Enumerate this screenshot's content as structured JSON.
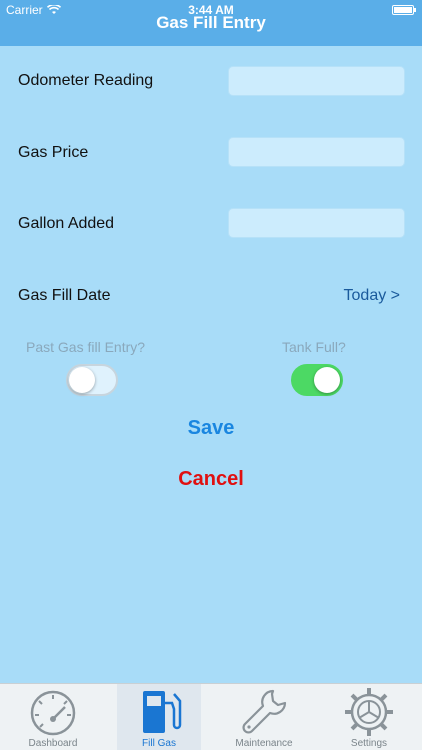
{
  "status": {
    "carrier": "Carrier",
    "time": "3:44 AM"
  },
  "nav": {
    "title": "Gas Fill Entry"
  },
  "form": {
    "odometer_label": "Odometer Reading",
    "odometer_value": "",
    "price_label": "Gas Price",
    "price_value": "",
    "gallon_label": "Gallon Added",
    "gallon_value": "",
    "date_label": "Gas Fill Date",
    "date_value": "Today >"
  },
  "toggles": {
    "past_label": "Past Gas fill Entry?",
    "past_on": false,
    "tank_label": "Tank Full?",
    "tank_on": true,
    "on_color": "#4cd964"
  },
  "actions": {
    "save": "Save",
    "cancel": "Cancel",
    "save_color": "#1a86e0",
    "cancel_color": "#e01010"
  },
  "tabs": [
    {
      "label": "Dashboard",
      "icon": "speedometer-icon",
      "active": false
    },
    {
      "label": "Fill Gas",
      "icon": "gas-pump-icon",
      "active": true
    },
    {
      "label": "Maintenance",
      "icon": "wrench-icon",
      "active": false
    },
    {
      "label": "Settings",
      "icon": "gear-icon",
      "active": false
    }
  ]
}
